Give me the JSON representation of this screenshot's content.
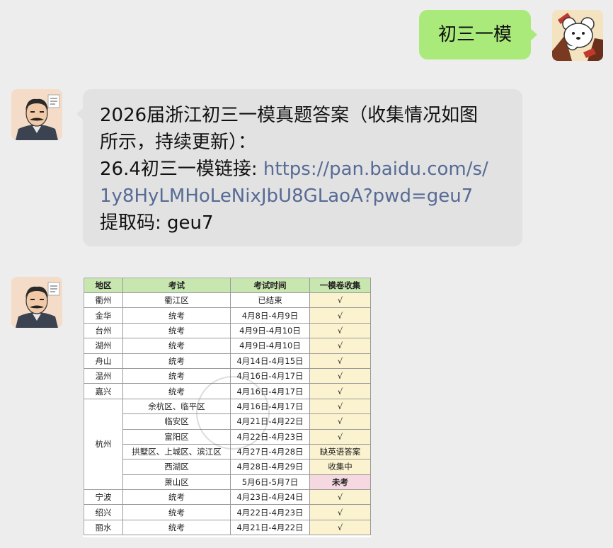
{
  "messages": {
    "outgoing": {
      "text": "初三一模"
    },
    "incoming": {
      "line1": "2026届浙江初三一模真题答案（收集情况如图",
      "line2": "所示，持续更新）：",
      "line3_prefix": "26.4初三一模链接: ",
      "link_part1": "https://pan.baidu.com/s/",
      "link_part2": "1y8HyLMHoLeNixJbU8GLaoA?pwd=geu7",
      "line5": "提取码: geu7"
    }
  },
  "table": {
    "headers": [
      "地区",
      "考试",
      "考试时间",
      "一模卷收集"
    ],
    "rows": [
      {
        "region": "衢州",
        "exam": "衢江区",
        "time": "已结束",
        "status": "√"
      },
      {
        "region": "金华",
        "exam": "统考",
        "time": "4月8日-4月9日",
        "status": "√"
      },
      {
        "region": "台州",
        "exam": "统考",
        "time": "4月9日-4月10日",
        "status": "√"
      },
      {
        "region": "湖州",
        "exam": "统考",
        "time": "4月9日-4月10日",
        "status": "√"
      },
      {
        "region": "舟山",
        "exam": "统考",
        "time": "4月14日-4月15日",
        "status": "√"
      },
      {
        "region": "温州",
        "exam": "统考",
        "time": "4月16日-4月17日",
        "status": "√"
      },
      {
        "region": "嘉兴",
        "exam": "统考",
        "time": "4月16日-4月17日",
        "status": "√"
      },
      {
        "region": "杭州",
        "exam": "余杭区、临平区",
        "time": "4月16日-4月17日",
        "status": "√"
      },
      {
        "region": "",
        "exam": "临安区",
        "time": "4月21日-4月22日",
        "status": "√"
      },
      {
        "region": "",
        "exam": "富阳区",
        "time": "4月22日-4月23日",
        "status": "√"
      },
      {
        "region": "",
        "exam": "拱墅区、上城区、滨江区",
        "time": "4月27日-4月28日",
        "status": "缺英语答案"
      },
      {
        "region": "",
        "exam": "西湖区",
        "time": "4月28日-4月29日",
        "status": "收集中"
      },
      {
        "region": "",
        "exam": "萧山区",
        "time": "5月6日-5月7日",
        "status": "未考"
      },
      {
        "region": "宁波",
        "exam": "统考",
        "time": "4月23日-4月24日",
        "status": "√"
      },
      {
        "region": "绍兴",
        "exam": "统考",
        "time": "4月22日-4月23日",
        "status": "√"
      },
      {
        "region": "丽水",
        "exam": "统考",
        "time": "4月21日-4月22日",
        "status": "√"
      }
    ]
  }
}
